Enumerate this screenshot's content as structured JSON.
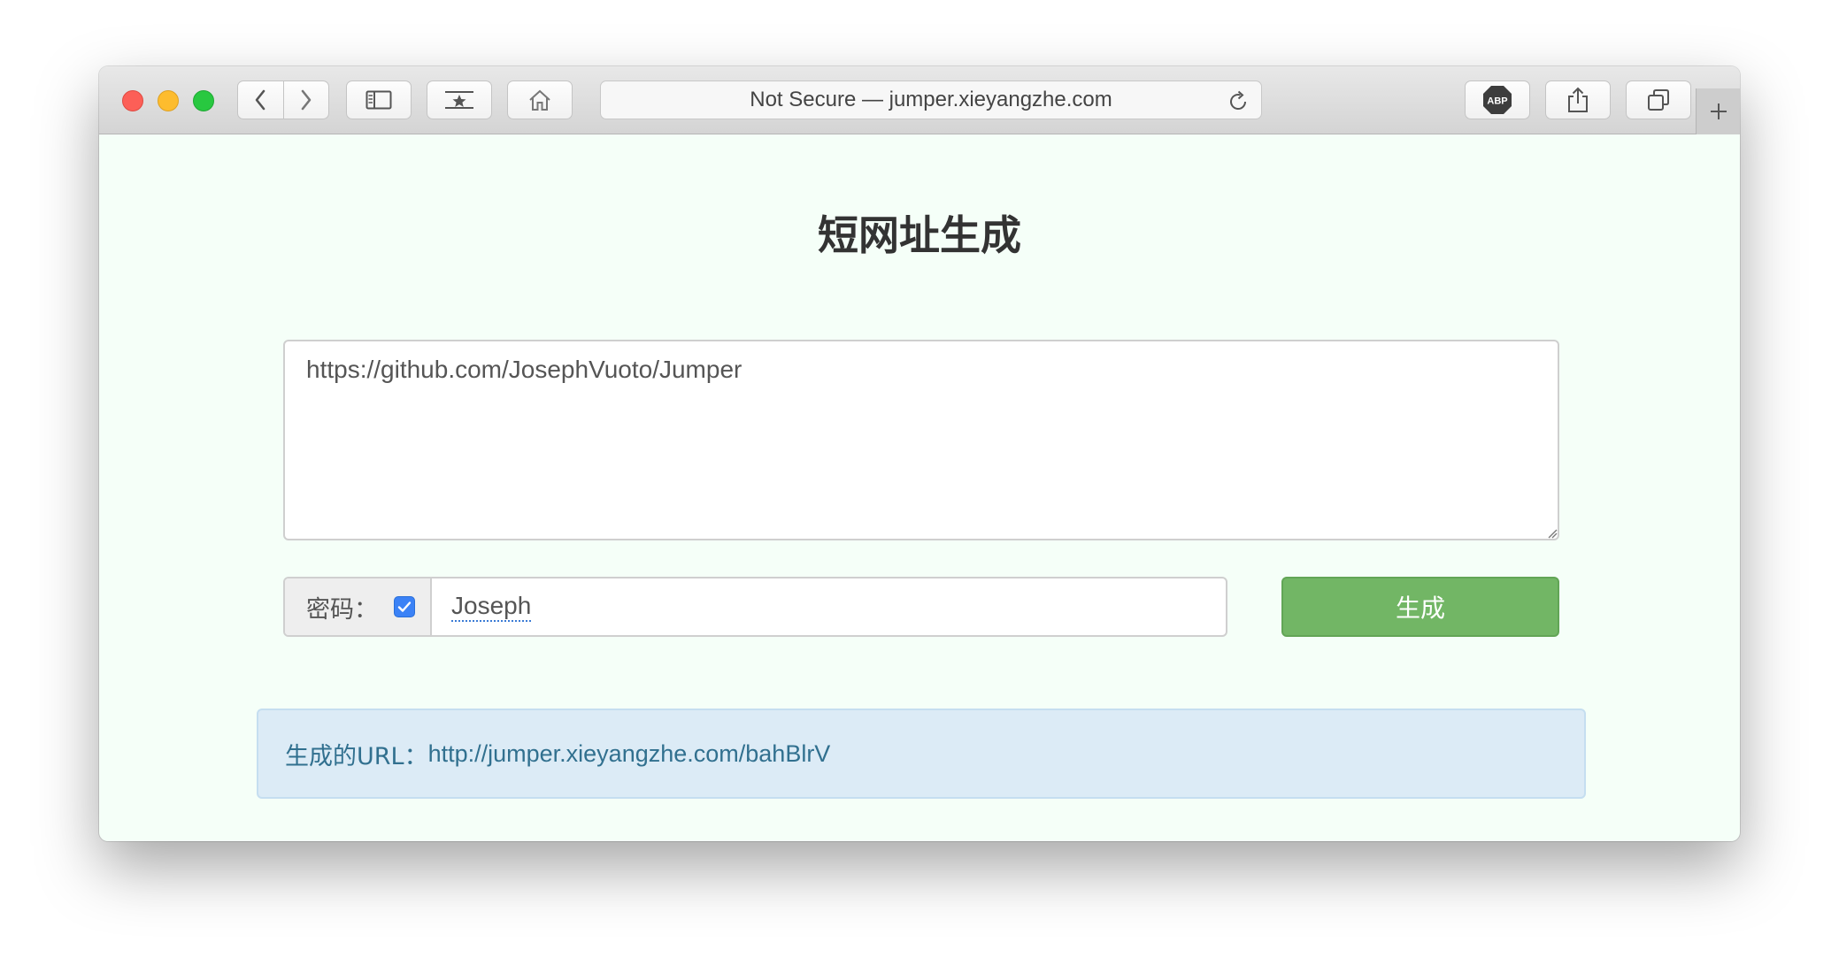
{
  "browser": {
    "address_text": "Not Secure — jumper.xieyangzhe.com",
    "adblock_label": "ABP"
  },
  "page": {
    "title": "短网址生成",
    "url_input_value": "https://github.com/JosephVuoto/Jumper",
    "password_label": "密码：",
    "password_checked": true,
    "password_value": "Joseph",
    "generate_button": "生成",
    "result_label": "生成的URL：",
    "result_url": "http://jumper.xieyangzhe.com/bahBlrV"
  },
  "colors": {
    "page_background": "#f5fff8",
    "generate_button": "#72b665",
    "result_background": "#dcebf6",
    "result_text": "#31708f",
    "checkbox": "#3b82f6"
  },
  "icons": {
    "back": "chevron-left-icon",
    "forward": "chevron-right-icon",
    "sidebar": "sidebar-icon",
    "bookmarks": "bookmarks-star-icon",
    "home": "home-icon",
    "reload": "reload-icon",
    "share": "share-icon",
    "tabs": "tabs-overview-icon",
    "new_tab": "plus-icon"
  }
}
